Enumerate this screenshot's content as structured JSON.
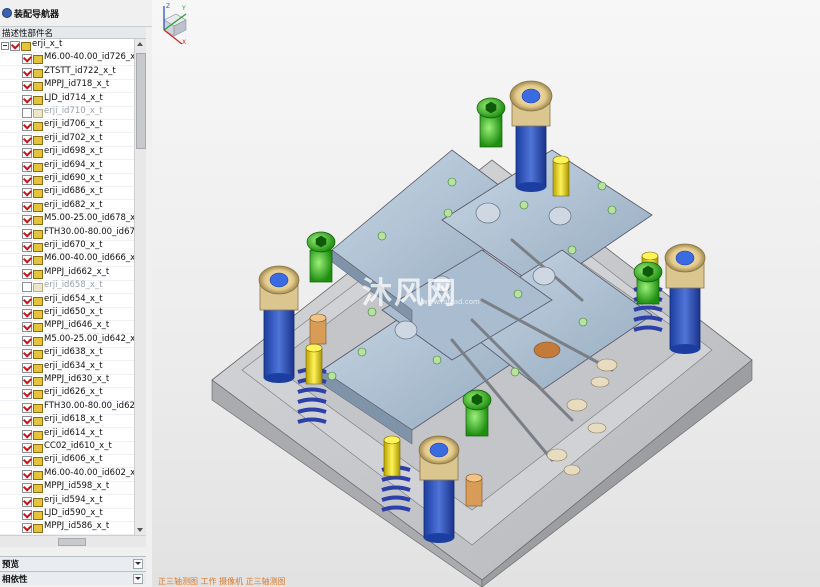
{
  "navigator": {
    "title": "装配导航器",
    "column_header": "描述性部件名",
    "root": "erji_x_t",
    "items": [
      {
        "label": "M6.00-40.00_id726_x",
        "checked": true,
        "dim": false
      },
      {
        "label": "ZTSTT_id722_x_t",
        "checked": true,
        "dim": false
      },
      {
        "label": "MPPJ_id718_x_t",
        "checked": true,
        "dim": false
      },
      {
        "label": "LJD_id714_x_t",
        "checked": true,
        "dim": false
      },
      {
        "label": "erji_id710_x_t",
        "checked": false,
        "dim": true
      },
      {
        "label": "erji_id706_x_t",
        "checked": true,
        "dim": false
      },
      {
        "label": "erji_id702_x_t",
        "checked": true,
        "dim": false
      },
      {
        "label": "erji_id698_x_t",
        "checked": true,
        "dim": false
      },
      {
        "label": "erji_id694_x_t",
        "checked": true,
        "dim": false
      },
      {
        "label": "erji_id690_x_t",
        "checked": true,
        "dim": false
      },
      {
        "label": "erji_id686_x_t",
        "checked": true,
        "dim": false
      },
      {
        "label": "erji_id682_x_t",
        "checked": true,
        "dim": false
      },
      {
        "label": "M5.00-25.00_id678_x",
        "checked": true,
        "dim": false
      },
      {
        "label": "FTH30.00-80.00_id67·",
        "checked": true,
        "dim": false
      },
      {
        "label": "erji_id670_x_t",
        "checked": true,
        "dim": false
      },
      {
        "label": "M6.00-40.00_id666_x",
        "checked": true,
        "dim": false
      },
      {
        "label": "MPPJ_id662_x_t",
        "checked": true,
        "dim": false
      },
      {
        "label": "erji_id658_x_t",
        "checked": false,
        "dim": true
      },
      {
        "label": "erji_id654_x_t",
        "checked": true,
        "dim": false
      },
      {
        "label": "erji_id650_x_t",
        "checked": true,
        "dim": false
      },
      {
        "label": "MPPJ_id646_x_t",
        "checked": true,
        "dim": false
      },
      {
        "label": "M5.00-25.00_id642_x",
        "checked": true,
        "dim": false
      },
      {
        "label": "erji_id638_x_t",
        "checked": true,
        "dim": false
      },
      {
        "label": "erji_id634_x_t",
        "checked": true,
        "dim": false
      },
      {
        "label": "MPPJ_id630_x_t",
        "checked": true,
        "dim": false
      },
      {
        "label": "erji_id626_x_t",
        "checked": true,
        "dim": false
      },
      {
        "label": "FTH30.00-80.00_id62.",
        "checked": true,
        "dim": false
      },
      {
        "label": "erji_id618_x_t",
        "checked": true,
        "dim": false
      },
      {
        "label": "erji_id614_x_t",
        "checked": true,
        "dim": false
      },
      {
        "label": "CC02_id610_x_t",
        "checked": true,
        "dim": false
      },
      {
        "label": "erji_id606_x_t",
        "checked": true,
        "dim": false
      },
      {
        "label": "M6.00-40.00_id602_x",
        "checked": true,
        "dim": false
      },
      {
        "label": "MPPJ_id598_x_t",
        "checked": true,
        "dim": false
      },
      {
        "label": "erji_id594_x_t",
        "checked": true,
        "dim": false
      },
      {
        "label": "LJD_id590_x_t",
        "checked": true,
        "dim": false
      },
      {
        "label": "MPPJ_id586_x_t",
        "checked": true,
        "dim": false
      }
    ],
    "sections": [
      "预览",
      "相依性"
    ]
  },
  "viewport": {
    "watermark": "沐风网",
    "watermark_sub": "www.mfcad.com",
    "status": "正三轴测图 工作 摄像机 正三轴测图",
    "triad_labels": {
      "x": "X",
      "y": "Y",
      "z": "Z"
    }
  }
}
